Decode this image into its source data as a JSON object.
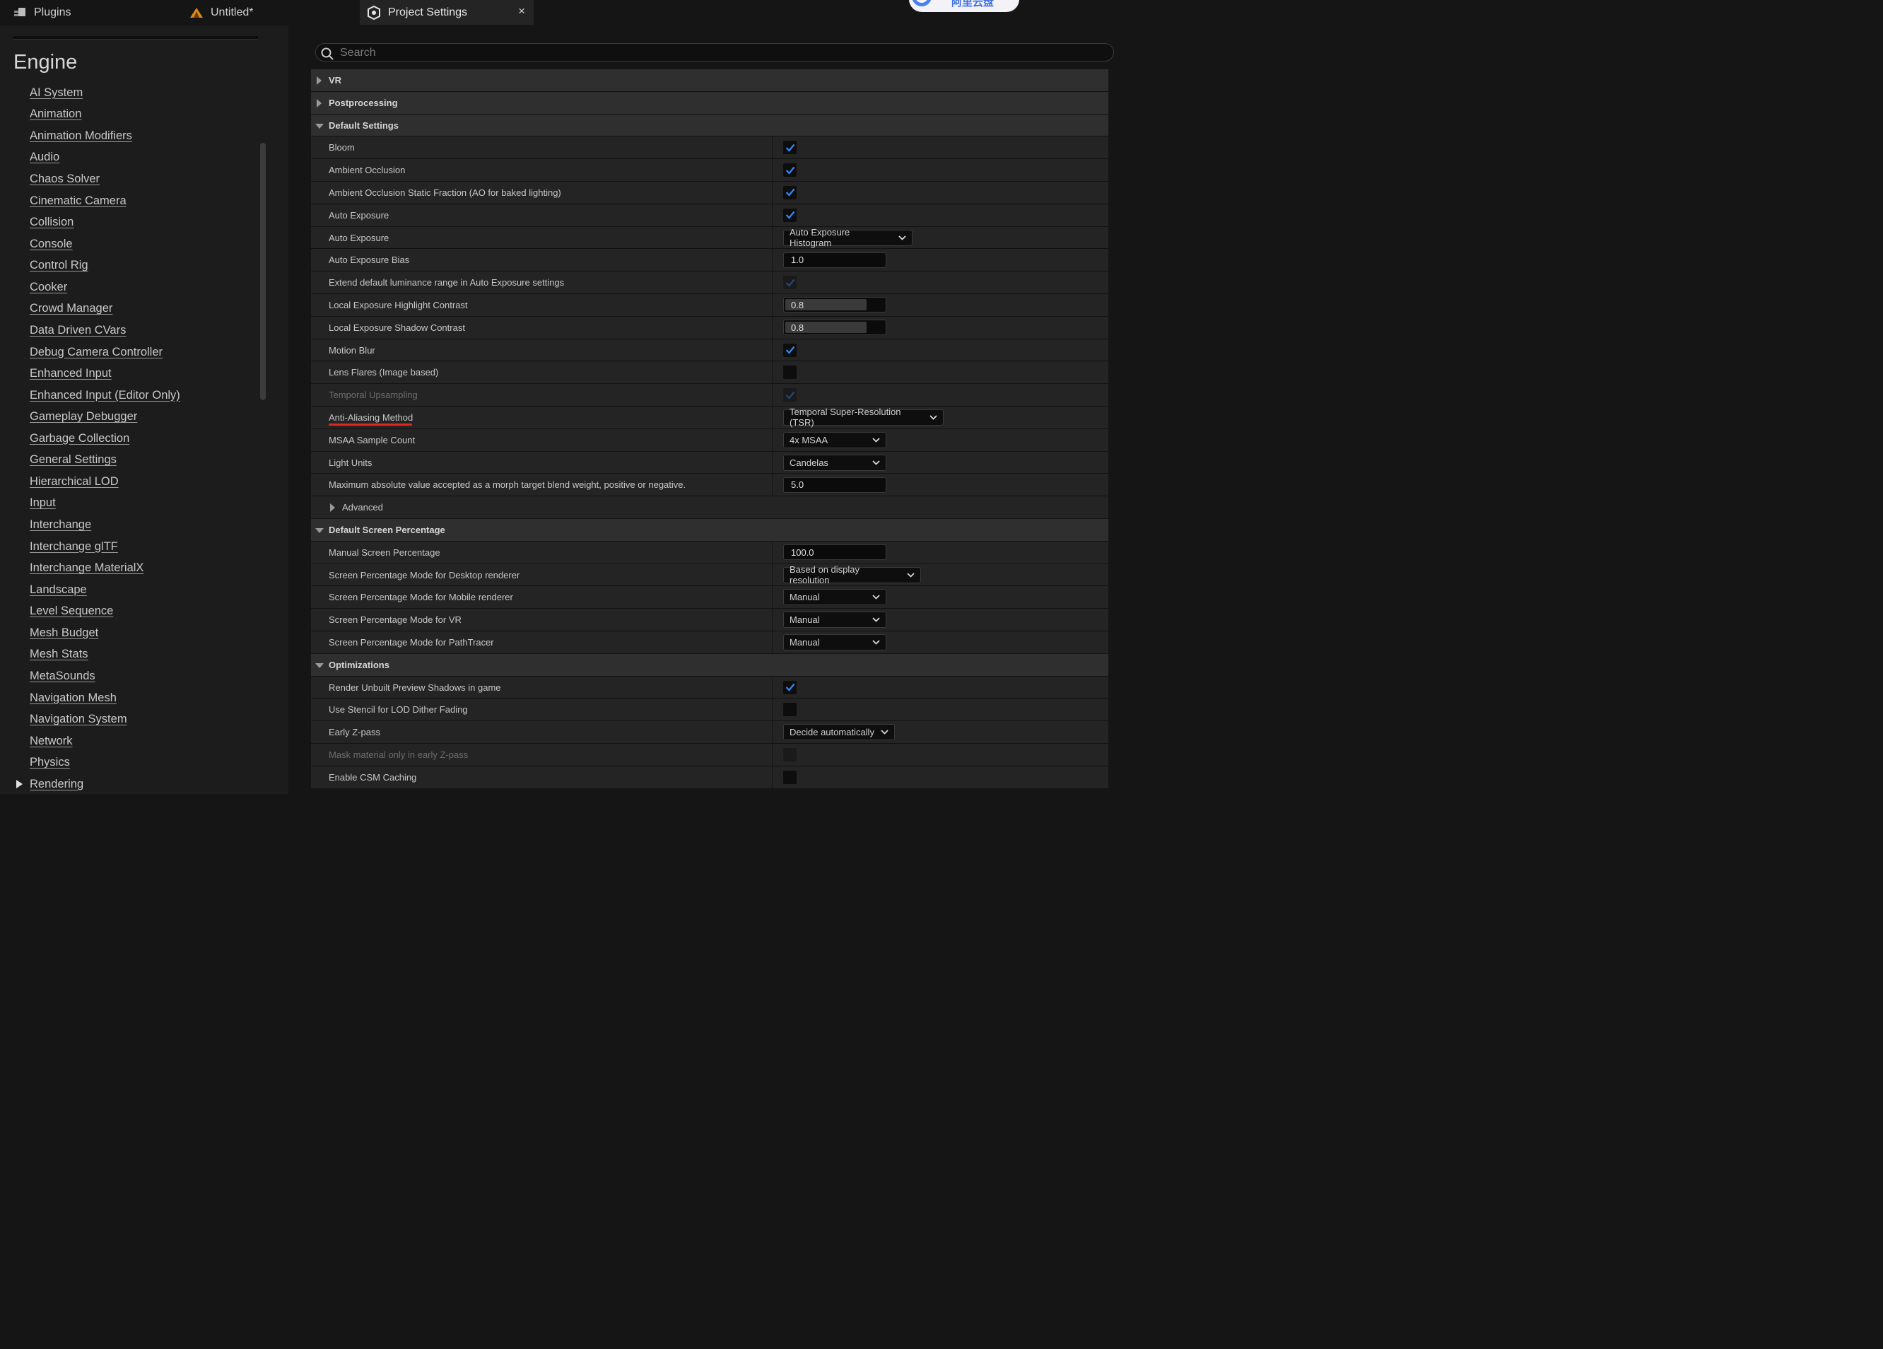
{
  "tabs": {
    "plugins": "Plugins",
    "untitled": "Untitled*",
    "project_settings": "Project Settings",
    "close": "×"
  },
  "overlay_badge_text": "阿里云盘",
  "sidebar": {
    "heading": "Engine",
    "items": [
      "AI System",
      "Animation",
      "Animation Modifiers",
      "Audio",
      "Chaos Solver",
      "Cinematic Camera",
      "Collision",
      "Console",
      "Control Rig",
      "Cooker",
      "Crowd Manager",
      "Data Driven CVars",
      "Debug Camera Controller",
      "Enhanced Input",
      "Enhanced Input (Editor Only)",
      "Gameplay Debugger",
      "Garbage Collection",
      "General Settings",
      "Hierarchical LOD",
      "Input",
      "Interchange",
      "Interchange glTF",
      "Interchange MaterialX",
      "Landscape",
      "Level Sequence",
      "Mesh Budget",
      "Mesh Stats",
      "MetaSounds",
      "Navigation Mesh",
      "Navigation System",
      "Network",
      "Physics",
      "Rendering"
    ]
  },
  "search": {
    "placeholder": "Search"
  },
  "colors": {
    "accent": "#2f8cff",
    "underline": "#e0281e"
  },
  "rows": [
    {
      "type": "cat",
      "label": "VR",
      "expanded": false
    },
    {
      "type": "cat",
      "label": "Postprocessing",
      "expanded": false
    },
    {
      "type": "cat",
      "label": "Default Settings",
      "expanded": true
    },
    {
      "type": "prop",
      "label": "Bloom",
      "control": "check",
      "checked": true
    },
    {
      "type": "prop",
      "label": "Ambient Occlusion",
      "control": "check",
      "checked": true
    },
    {
      "type": "prop",
      "label": "Ambient Occlusion Static Fraction (AO for baked lighting)",
      "control": "check",
      "checked": true
    },
    {
      "type": "prop",
      "label": "Auto Exposure",
      "control": "check",
      "checked": true
    },
    {
      "type": "prop",
      "label": "Auto Exposure",
      "control": "dropdown",
      "value": "Auto Exposure Histogram"
    },
    {
      "type": "prop",
      "label": "Auto Exposure Bias",
      "control": "number",
      "value": "1.0"
    },
    {
      "type": "prop",
      "label": "Extend default luminance range in Auto Exposure settings",
      "control": "check",
      "checked": true,
      "disabled": true
    },
    {
      "type": "prop",
      "label": "Local Exposure Highlight Contrast",
      "control": "slider",
      "value": "0.8",
      "fraction": 0.8
    },
    {
      "type": "prop",
      "label": "Local Exposure Shadow Contrast",
      "control": "slider",
      "value": "0.8",
      "fraction": 0.8
    },
    {
      "type": "prop",
      "label": "Motion Blur",
      "control": "check",
      "checked": true
    },
    {
      "type": "prop",
      "label": "Lens Flares (Image based)",
      "control": "check",
      "checked": false
    },
    {
      "type": "prop",
      "label": "Temporal Upsampling",
      "control": "check",
      "checked": true,
      "disabled": true,
      "dimLabel": true
    },
    {
      "type": "prop",
      "label": "Anti-Aliasing Method",
      "control": "dropdown",
      "value": "Temporal Super-Resolution (TSR)",
      "highlight": true
    },
    {
      "type": "prop",
      "label": "MSAA Sample Count",
      "control": "dropdown",
      "value": "4x MSAA"
    },
    {
      "type": "prop",
      "label": "Light Units",
      "control": "dropdown",
      "value": "Candelas"
    },
    {
      "type": "prop",
      "label": "Maximum absolute value accepted as a morph target blend weight, positive or negative.",
      "control": "number",
      "value": "5.0"
    },
    {
      "type": "sub",
      "label": "Advanced",
      "expanded": false
    },
    {
      "type": "cat",
      "label": "Default Screen Percentage",
      "expanded": true
    },
    {
      "type": "prop",
      "label": "Manual Screen Percentage",
      "control": "number",
      "value": "100.0"
    },
    {
      "type": "prop",
      "label": "Screen Percentage Mode for Desktop renderer",
      "control": "dropdown",
      "value": "Based on display resolution"
    },
    {
      "type": "prop",
      "label": "Screen Percentage Mode for Mobile renderer",
      "control": "dropdown",
      "value": "Manual"
    },
    {
      "type": "prop",
      "label": "Screen Percentage Mode for VR",
      "control": "dropdown",
      "value": "Manual"
    },
    {
      "type": "prop",
      "label": "Screen Percentage Mode for PathTracer",
      "control": "dropdown",
      "value": "Manual"
    },
    {
      "type": "cat",
      "label": "Optimizations",
      "expanded": true
    },
    {
      "type": "prop",
      "label": "Render Unbuilt Preview Shadows in game",
      "control": "check",
      "checked": true
    },
    {
      "type": "prop",
      "label": "Use Stencil for LOD Dither Fading",
      "control": "check",
      "checked": false
    },
    {
      "type": "prop",
      "label": "Early Z-pass",
      "control": "dropdown",
      "value": "Decide automatically"
    },
    {
      "type": "prop",
      "label": "Mask material only in early Z-pass",
      "control": "check",
      "checked": false,
      "disabled": true,
      "dimLabel": true
    },
    {
      "type": "prop",
      "label": "Enable CSM Caching",
      "control": "check",
      "checked": false
    }
  ]
}
